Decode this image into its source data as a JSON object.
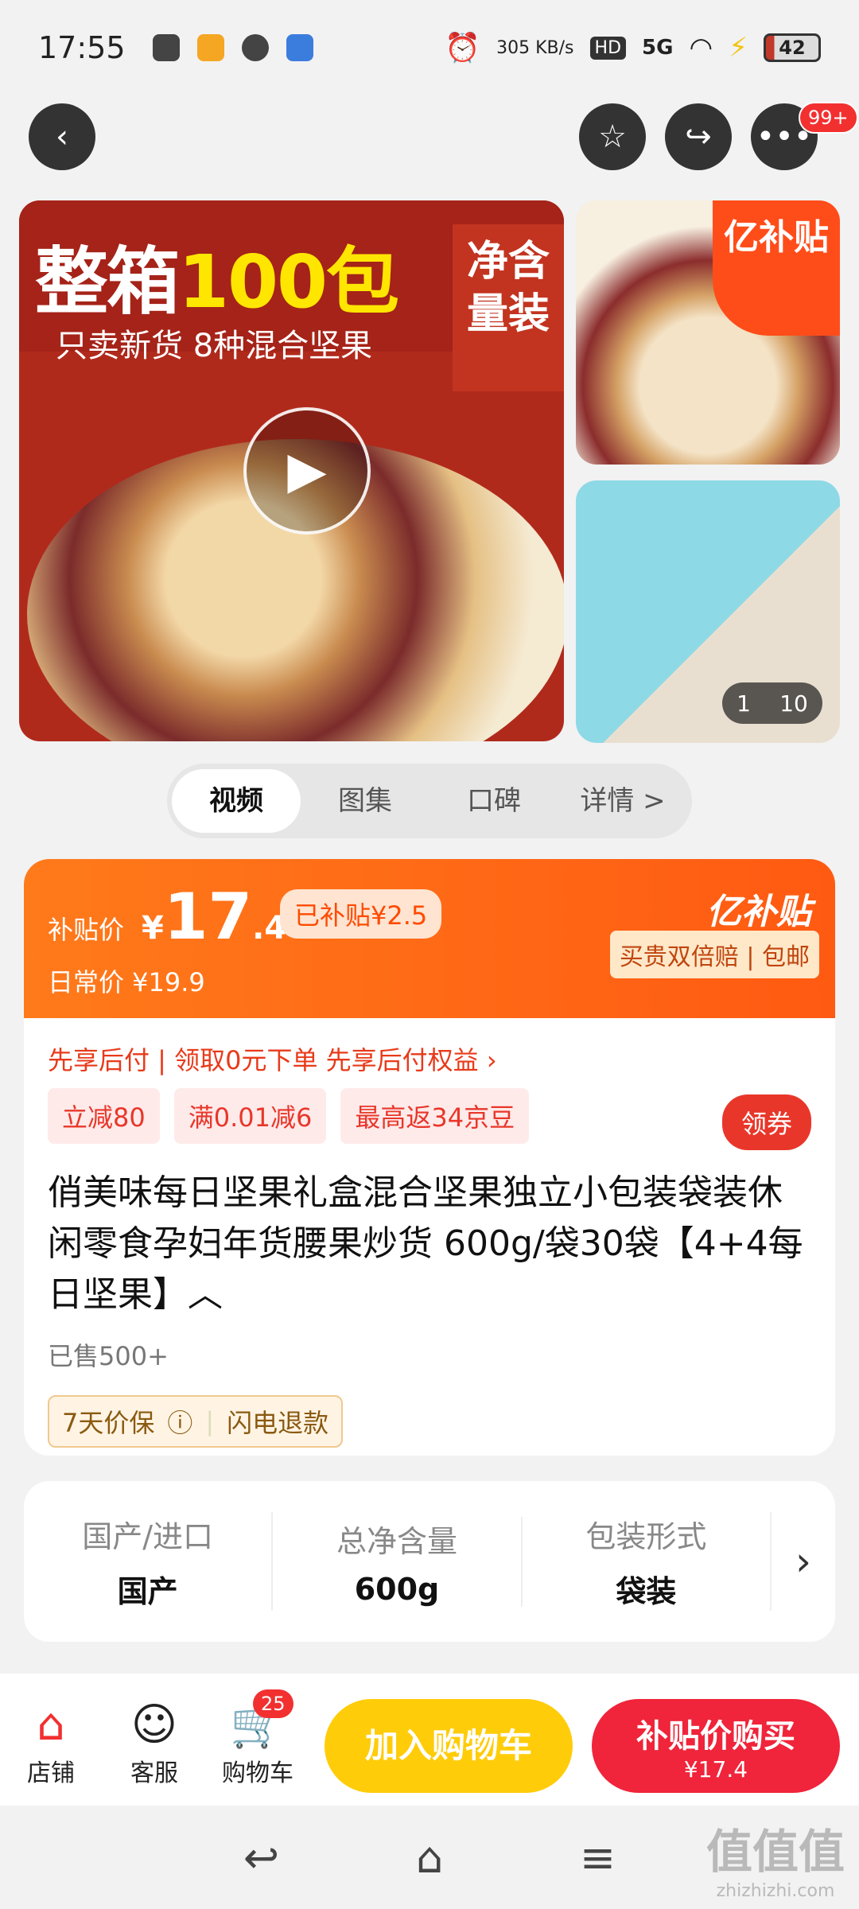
{
  "status": {
    "time": "17:55",
    "net_speed": "305 KB/s",
    "hd": "HD",
    "signal": "5G",
    "battery": "42"
  },
  "header": {
    "notifications_badge": "99+"
  },
  "gallery": {
    "hero_title_a": "整箱",
    "hero_title_b": "100包",
    "hero_sub": "只卖新货 8种混合坚果",
    "hero_side": "净含量装",
    "subsidy_tag": "亿补贴",
    "counter_current": "1",
    "counter_total": "10"
  },
  "tabs": [
    "视频",
    "图集",
    "口碑",
    "详情 >"
  ],
  "price": {
    "label": "补贴价",
    "currency": "¥",
    "int": "17",
    "dec": ".4",
    "subsidized": "已补贴¥2.5",
    "daily": "日常价 ¥19.9",
    "brand": "亿补贴",
    "guarantee": "买贵双倍赔 | 包邮"
  },
  "pay_later": "先享后付 | 领取0元下单 先享后付权益 ›",
  "coupons": [
    "立减80",
    "满0.01减6",
    "最高返34京豆"
  ],
  "get_coupon": "领券",
  "product": {
    "title": "俏美味每日坚果礼盒混合坚果独立小包装袋装休闲零食孕妇年货腰果炒货 600g/袋30袋【4+4每日坚果】︿",
    "sold": "已售500+",
    "protect_a": "7天价保",
    "protect_b": "闪电退款"
  },
  "specs": [
    {
      "k": "国产/进口",
      "v": "国产"
    },
    {
      "k": "总净含量",
      "v": "600g"
    },
    {
      "k": "包装形式",
      "v": "袋装"
    }
  ],
  "bottom": {
    "store": "店铺",
    "service": "客服",
    "cart": "购物车",
    "cart_badge": "25",
    "add_cart": "加入购物车",
    "buy_title": "补贴价购买",
    "buy_price": "¥17.4"
  },
  "watermark": {
    "w1": "值值值",
    "w2": "zhizhizhi.com"
  }
}
